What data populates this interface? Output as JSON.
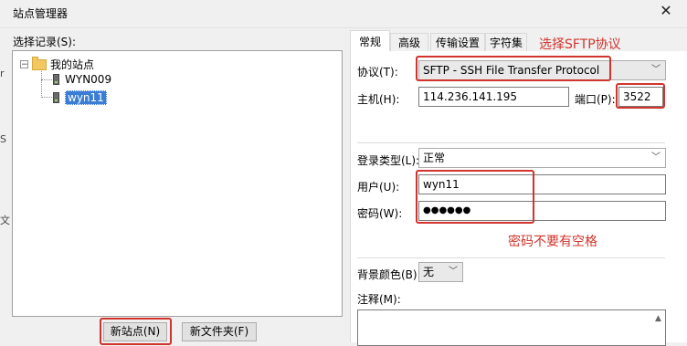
{
  "window": {
    "title": "站点管理器"
  },
  "tree": {
    "label": "选择记录(S):",
    "root": "我的站点",
    "items": [
      "WYN009",
      "wyn11"
    ],
    "expander": "−"
  },
  "buttons": {
    "new_site": "新站点(N)",
    "new_folder": "新文件夹(F)"
  },
  "tabs": [
    "常规",
    "高级",
    "传输设置",
    "字符集"
  ],
  "annotations": {
    "select_sftp": "选择SFTP协议",
    "no_space_password": "密码不要有空格"
  },
  "form": {
    "protocol_label": "协议(T):",
    "protocol_value": "SFTP - SSH File Transfer Protocol",
    "host_label": "主机(H):",
    "host_value": "114.236.141.195",
    "port_label": "端口(P):",
    "port_value": "3522",
    "login_type_label": "登录类型(L):",
    "login_type_value": "正常",
    "user_label": "用户(U):",
    "user_value": "wyn11",
    "password_label": "密码(W):",
    "password_value": "●●●●●●",
    "bg_color_label": "背景颜色(B)",
    "bg_color_value": "无",
    "comment_label": "注释(M):"
  },
  "edge_glyphs": [
    "r",
    "S",
    "文"
  ],
  "colors": {
    "annotation_red": "#d0342c",
    "selection_blue": "#3b7cd4"
  }
}
